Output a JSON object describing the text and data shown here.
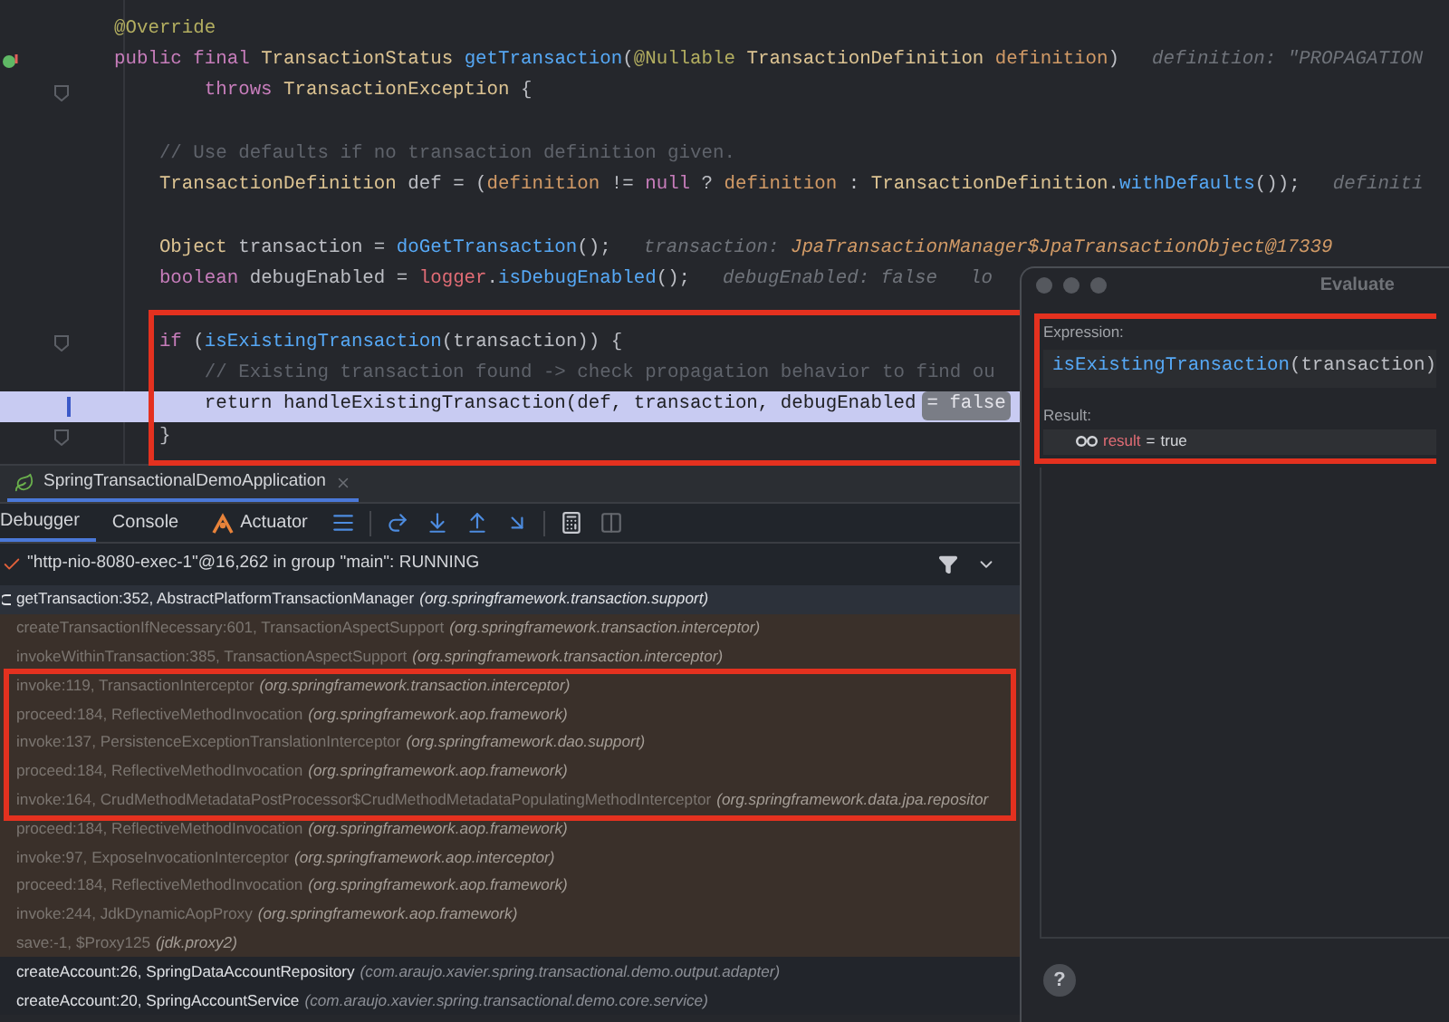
{
  "editor": {
    "lines": [
      {
        "kind": "code",
        "current": false,
        "tokens": [
          {
            "text": "@Override",
            "kind": "annotation"
          }
        ]
      },
      {
        "kind": "method-header",
        "current": false,
        "tokens": [
          {
            "text": "public final ",
            "kind": "keyword"
          },
          {
            "text": "TransactionStatus ",
            "kind": "type"
          },
          {
            "text": "getTransaction",
            "kind": "method"
          },
          {
            "text": "(",
            "kind": "plain"
          },
          {
            "text": "@Nullable ",
            "kind": "annotation"
          },
          {
            "text": "TransactionDefinition ",
            "kind": "type"
          },
          {
            "text": "definition",
            "kind": "param"
          },
          {
            "text": ")",
            "kind": "plain"
          },
          {
            "text": "definition: \"PROPAGATION",
            "kind": "hint"
          }
        ]
      },
      {
        "kind": "fold",
        "current": false,
        "tokens": [
          {
            "text": "        throws ",
            "kind": "keyword"
          },
          {
            "text": "TransactionException ",
            "kind": "type"
          },
          {
            "text": "{",
            "kind": "plain"
          }
        ]
      },
      {
        "kind": "blank",
        "current": false
      },
      {
        "kind": "code",
        "current": false,
        "tokens": [
          {
            "text": "    // Use defaults if no transaction definition given.",
            "kind": "comment"
          }
        ]
      },
      {
        "kind": "code",
        "current": false,
        "tokens": [
          {
            "text": "    TransactionDefinition ",
            "kind": "type"
          },
          {
            "text": "def = (",
            "kind": "plain"
          },
          {
            "text": "definition ",
            "kind": "param"
          },
          {
            "text": "!= ",
            "kind": "plain"
          },
          {
            "text": "null ",
            "kind": "keyword"
          },
          {
            "text": "? ",
            "kind": "plain"
          },
          {
            "text": "definition ",
            "kind": "param"
          },
          {
            "text": ": ",
            "kind": "plain"
          },
          {
            "text": "TransactionDefinition",
            "kind": "type"
          },
          {
            "text": ".",
            "kind": "plain"
          },
          {
            "text": "withDefaults",
            "kind": "method"
          },
          {
            "text": "());",
            "kind": "plain"
          },
          {
            "text": "definiti",
            "kind": "hint"
          }
        ]
      },
      {
        "kind": "blank",
        "current": false
      },
      {
        "kind": "code",
        "current": false,
        "tokens": [
          {
            "text": "    Object ",
            "kind": "type"
          },
          {
            "text": "transaction = ",
            "kind": "plain"
          },
          {
            "text": "doGetTransaction",
            "kind": "method"
          },
          {
            "text": "();",
            "kind": "plain"
          },
          {
            "text": "transaction: ",
            "kind": "hint"
          },
          {
            "text": "JpaTransactionManager$JpaTransactionObject@17339",
            "kind": "hint-value"
          }
        ]
      },
      {
        "kind": "code",
        "current": false,
        "tokens": [
          {
            "text": "    boolean ",
            "kind": "keyword"
          },
          {
            "text": "debugEnabled = ",
            "kind": "plain"
          },
          {
            "text": "logger",
            "kind": "field"
          },
          {
            "text": ".",
            "kind": "plain"
          },
          {
            "text": "isDebugEnabled",
            "kind": "method"
          },
          {
            "text": "();",
            "kind": "plain"
          },
          {
            "text": "debugEnabled: false",
            "kind": "hint"
          },
          {
            "text": "lo",
            "kind": "hint"
          }
        ]
      },
      {
        "kind": "blank",
        "current": false
      },
      {
        "kind": "fold",
        "current": false,
        "tokens": [
          {
            "text": "    if ",
            "kind": "keyword"
          },
          {
            "text": "(",
            "kind": "plain"
          },
          {
            "text": "isExistingTransaction",
            "kind": "method"
          },
          {
            "text": "(transaction)) {",
            "kind": "plain"
          }
        ]
      },
      {
        "kind": "code",
        "current": false,
        "tokens": [
          {
            "text": "        // Existing transaction found -> check propagation behavior to find ou",
            "kind": "comment"
          }
        ]
      },
      {
        "kind": "code",
        "current": true,
        "tokens": [
          {
            "text": "        return handleExistingTransaction(def, transaction, debugEnabled",
            "kind": "plain"
          },
          {
            "text": "= false",
            "kind": "inline-value"
          }
        ]
      },
      {
        "kind": "fold",
        "current": false,
        "tokens": [
          {
            "text": "    }",
            "kind": "plain"
          }
        ]
      }
    ]
  },
  "debug_panel": {
    "session_tab": {
      "label": "SpringTransactionalDemoApplication",
      "selected": true
    },
    "tabs": [
      {
        "label": "Debugger",
        "selected": true
      },
      {
        "label": "Console",
        "selected": false
      },
      {
        "label": "Actuator",
        "selected": false
      }
    ],
    "thread": "\"http-nio-8080-exec-1\"@16,262 in group \"main\": RUNNING",
    "frames": [
      {
        "kind": "current",
        "method": "getTransaction:352, AbstractPlatformTransactionManager",
        "package": "(org.springframework.transaction.support)"
      },
      {
        "kind": "library",
        "method": "createTransactionIfNecessary:601, TransactionAspectSupport",
        "package": "(org.springframework.transaction.interceptor)"
      },
      {
        "kind": "library",
        "method": "invokeWithinTransaction:385, TransactionAspectSupport",
        "package": "(org.springframework.transaction.interceptor)"
      },
      {
        "kind": "library",
        "method": "invoke:119, TransactionInterceptor",
        "package": "(org.springframework.transaction.interceptor)"
      },
      {
        "kind": "library",
        "method": "proceed:184, ReflectiveMethodInvocation",
        "package": "(org.springframework.aop.framework)"
      },
      {
        "kind": "library",
        "method": "invoke:137, PersistenceExceptionTranslationInterceptor",
        "package": "(org.springframework.dao.support)"
      },
      {
        "kind": "library",
        "method": "proceed:184, ReflectiveMethodInvocation",
        "package": "(org.springframework.aop.framework)"
      },
      {
        "kind": "library",
        "method": "invoke:164, CrudMethodMetadataPostProcessor$CrudMethodMetadataPopulatingMethodInterceptor",
        "package": "(org.springframework.data.jpa.repositor"
      },
      {
        "kind": "library",
        "method": "proceed:184, ReflectiveMethodInvocation",
        "package": "(org.springframework.aop.framework)"
      },
      {
        "kind": "library",
        "method": "invoke:97, ExposeInvocationInterceptor",
        "package": "(org.springframework.aop.interceptor)"
      },
      {
        "kind": "library",
        "method": "proceed:184, ReflectiveMethodInvocation",
        "package": "(org.springframework.aop.framework)"
      },
      {
        "kind": "library",
        "method": "invoke:244, JdkDynamicAopProxy",
        "package": "(org.springframework.aop.framework)"
      },
      {
        "kind": "library",
        "method": "save:-1, $Proxy125",
        "package": "(jdk.proxy2)"
      },
      {
        "kind": "user",
        "method": "createAccount:26, SpringDataAccountRepository",
        "package": "(com.araujo.xavier.spring.transactional.demo.output.adapter)"
      },
      {
        "kind": "user",
        "method": "createAccount:20, SpringAccountService",
        "package": "(com.araujo.xavier.spring.transactional.demo.core.service)"
      }
    ]
  },
  "evaluate_dialog": {
    "title": "Evaluate",
    "expression_label": "Expression:",
    "expression": [
      {
        "text": "isExistingTransaction",
        "kind": "method"
      },
      {
        "text": "(transaction)",
        "kind": "plain"
      }
    ],
    "result_label": "Result:",
    "result": {
      "name": "result",
      "operator": "=",
      "value": "true"
    },
    "help_button": "?"
  }
}
